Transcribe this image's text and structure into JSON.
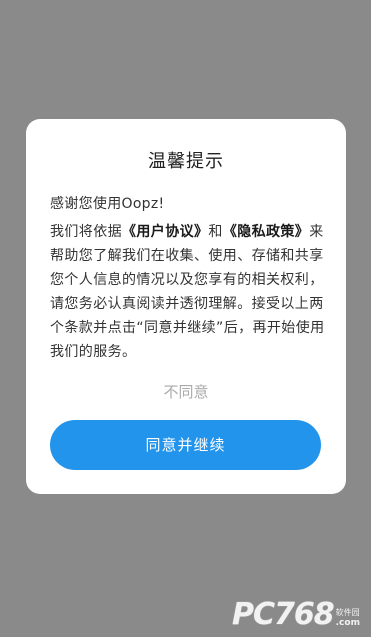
{
  "dialog": {
    "title": "温馨提示",
    "greeting": "感谢您使用Oopz!",
    "body_prefix": "我们将依据",
    "user_agreement_link": "《用户协议》",
    "and_text": "和",
    "privacy_policy_link": "《隐私政策》",
    "body_suffix": "来帮助您了解我们在收集、使用、存储和共享您个人信息的情况以及您享有的相关权利，请您务必认真阅读并透彻理解。接受以上两个条款并点击“同意并继续”后，再开始使用我们的服务。",
    "disagree_label": "不同意",
    "agree_label": "同意并继续"
  },
  "watermark": {
    "logo": "PC768",
    "subtitle": "软件园",
    "domain": ".com"
  },
  "colors": {
    "overlay": "#8a8a8a",
    "accent": "#2394ec",
    "disagree_text": "#aaaaaa"
  }
}
